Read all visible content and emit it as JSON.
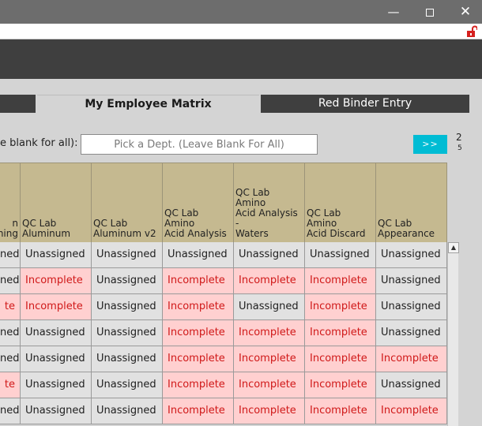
{
  "window": {
    "minimize_glyph": "—",
    "close_glyph": "✕"
  },
  "tabs": [
    {
      "label": ""
    },
    {
      "label": "My Employee Matrix"
    },
    {
      "label": "Red Binder Entry"
    }
  ],
  "filter": {
    "label": "e blank for all):",
    "placeholder": "Pick a Dept. (Leave Blank For All)",
    "go_label": ">>",
    "side_num": "2",
    "side_num2": "5"
  },
  "matrix": {
    "headers": [
      "n\nning",
      "QC Lab\nAluminum",
      "QC Lab\nAluminum v2",
      "QC Lab Amino\nAcid Analysis",
      "QC Lab Amino\nAcid Analysis -\nWaters",
      "QC Lab Amino\nAcid Discard",
      "QC Lab\nAppearance"
    ],
    "rows": [
      [
        "ned",
        "Unassigned",
        "Unassigned",
        "Unassigned",
        "Unassigned",
        "Unassigned",
        "Unassigned"
      ],
      [
        "ned",
        "Incomplete",
        "Unassigned",
        "Incomplete",
        "Incomplete",
        "Incomplete",
        "Unassigned"
      ],
      [
        "te",
        "Incomplete",
        "Unassigned",
        "Incomplete",
        "Unassigned",
        "Incomplete",
        "Unassigned"
      ],
      [
        "ned",
        "Unassigned",
        "Unassigned",
        "Incomplete",
        "Incomplete",
        "Incomplete",
        "Unassigned"
      ],
      [
        "ned",
        "Unassigned",
        "Unassigned",
        "Incomplete",
        "Incomplete",
        "Incomplete",
        "Incomplete"
      ],
      [
        "te",
        "Unassigned",
        "Unassigned",
        "Incomplete",
        "Incomplete",
        "Incomplete",
        "Unassigned"
      ],
      [
        "ned",
        "Unassigned",
        "Unassigned",
        "Incomplete",
        "Incomplete",
        "Incomplete",
        "Incomplete"
      ]
    ]
  },
  "colors": {
    "header_bg": "#c5b990",
    "unassigned_bg": "#e1e1e1",
    "incomplete_bg": "#ffd0d0",
    "incomplete_text": "#d01818",
    "accent": "#00bcd4",
    "dark_band": "#3f3f3f"
  }
}
